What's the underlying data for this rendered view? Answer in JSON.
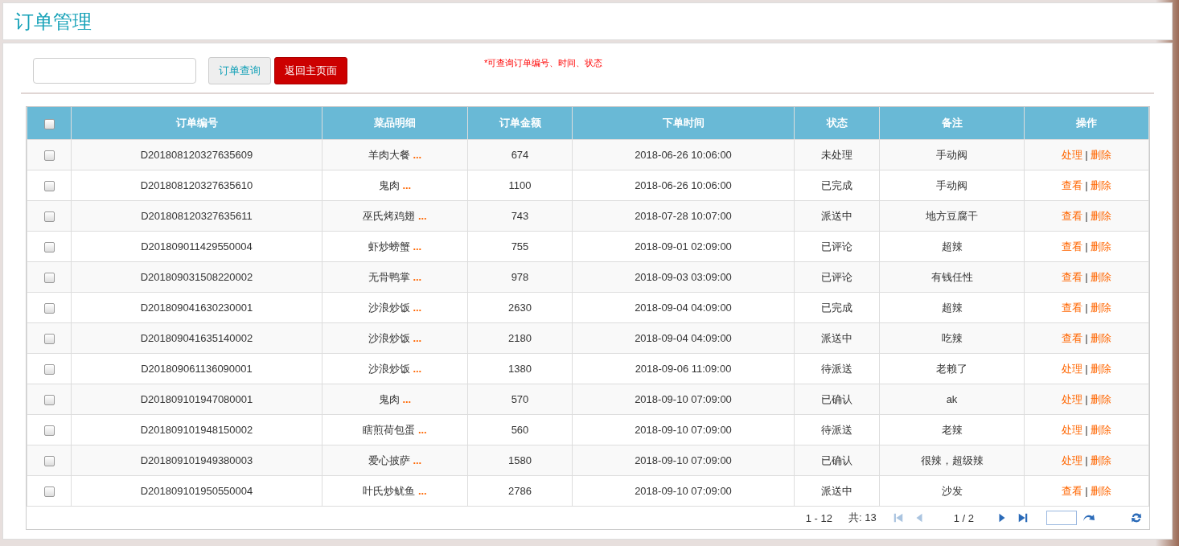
{
  "page_title": "订单管理",
  "search": {
    "query_button": "订单查询",
    "home_button": "返回主页面",
    "hint": "*可查询订单编号、时间、状态"
  },
  "table": {
    "select_all": {
      "checked": false
    },
    "columns": [
      "订单编号",
      "菜品明细",
      "订单金额",
      "下单时间",
      "状态",
      "备注",
      "操作"
    ],
    "rows": [
      {
        "checked": false,
        "order_no": "D201808120327635609",
        "dish": "羊肉大餐",
        "more": "...",
        "amount": "674",
        "time": "2018-06-26 10:06:00",
        "status": "未处理",
        "note": "手动阀",
        "action": "处理",
        "separator": "|",
        "delete": "删除"
      },
      {
        "checked": false,
        "order_no": "D201808120327635610",
        "dish": "鬼肉",
        "more": "...",
        "amount": "1100",
        "time": "2018-06-26 10:06:00",
        "status": "已完成",
        "note": "手动阀",
        "action": "查看",
        "separator": "|",
        "delete": "删除"
      },
      {
        "checked": false,
        "order_no": "D201808120327635611",
        "dish": "巫氏烤鸡翅",
        "more": "...",
        "amount": "743",
        "time": "2018-07-28 10:07:00",
        "status": "派送中",
        "note": "地方豆腐干",
        "action": "查看",
        "separator": "|",
        "delete": "删除"
      },
      {
        "checked": false,
        "order_no": "D201809011429550004",
        "dish": "虾炒螃蟹",
        "more": "...",
        "amount": "755",
        "time": "2018-09-01 02:09:00",
        "status": "已评论",
        "note": "超辣",
        "action": "查看",
        "separator": "|",
        "delete": "删除"
      },
      {
        "checked": false,
        "order_no": "D201809031508220002",
        "dish": "无骨鸭掌",
        "more": "...",
        "amount": "978",
        "time": "2018-09-03 03:09:00",
        "status": "已评论",
        "note": "有钱任性",
        "action": "查看",
        "separator": "|",
        "delete": "删除"
      },
      {
        "checked": false,
        "order_no": "D201809041630230001",
        "dish": "沙浪炒饭",
        "more": "...",
        "amount": "2630",
        "time": "2018-09-04 04:09:00",
        "status": "已完成",
        "note": "超辣",
        "action": "查看",
        "separator": "|",
        "delete": "删除"
      },
      {
        "checked": false,
        "order_no": "D201809041635140002",
        "dish": "沙浪炒饭",
        "more": "...",
        "amount": "2180",
        "time": "2018-09-04 04:09:00",
        "status": "派送中",
        "note": "吃辣",
        "action": "查看",
        "separator": "|",
        "delete": "删除"
      },
      {
        "checked": false,
        "order_no": "D201809061136090001",
        "dish": "沙浪炒饭",
        "more": "...",
        "amount": "1380",
        "time": "2018-09-06 11:09:00",
        "status": "待派送",
        "note": "老赖了",
        "action": "处理",
        "separator": "|",
        "delete": "删除"
      },
      {
        "checked": false,
        "order_no": "D201809101947080001",
        "dish": "鬼肉",
        "more": "...",
        "amount": "570",
        "time": "2018-09-10 07:09:00",
        "status": "已确认",
        "note": "ak",
        "action": "处理",
        "separator": "|",
        "delete": "删除"
      },
      {
        "checked": false,
        "order_no": "D201809101948150002",
        "dish": "瞎煎荷包蛋",
        "more": "...",
        "amount": "560",
        "time": "2018-09-10 07:09:00",
        "status": "待派送",
        "note": "老辣",
        "action": "处理",
        "separator": "|",
        "delete": "删除"
      },
      {
        "checked": false,
        "order_no": "D201809101949380003",
        "dish": "爱心披萨",
        "more": "...",
        "amount": "1580",
        "time": "2018-09-10 07:09:00",
        "status": "已确认",
        "note": "很辣，超级辣",
        "action": "处理",
        "separator": "|",
        "delete": "删除"
      },
      {
        "checked": false,
        "order_no": "D201809101950550004",
        "dish": "叶氏炒鱿鱼",
        "more": "...",
        "amount": "2786",
        "time": "2018-09-10 07:09:00",
        "status": "派送中",
        "note": "沙发",
        "action": "查看",
        "separator": "|",
        "delete": "删除"
      }
    ]
  },
  "pagination": {
    "range": "1 - 12",
    "total": "共: 13",
    "first": {
      "disabled": true
    },
    "prev": {
      "disabled": true
    },
    "page": "1 / 2",
    "next": {
      "disabled": false
    },
    "last": {
      "disabled": false
    }
  }
}
